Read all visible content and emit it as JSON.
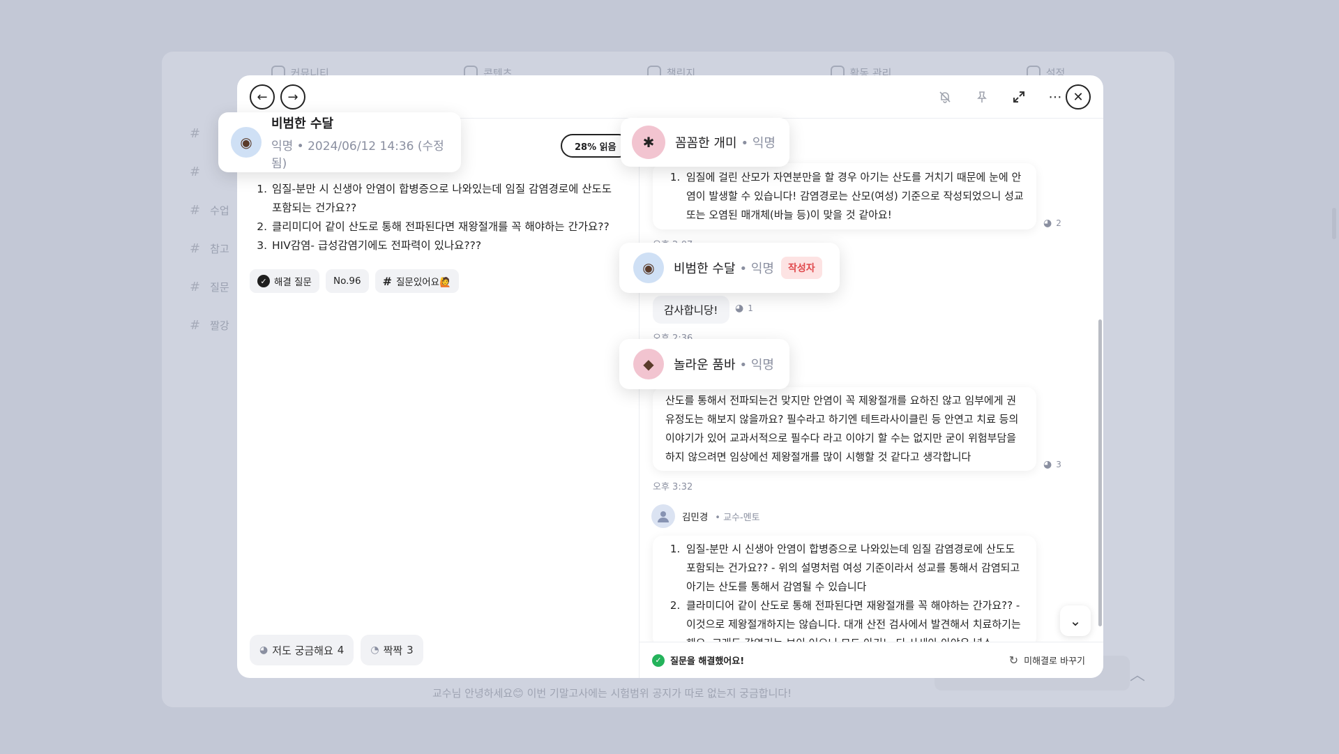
{
  "background": {
    "nav": [
      "커뮤니티",
      "콘텐츠",
      "챌린지",
      "활동 관리",
      "설정"
    ],
    "sidebar": [
      "",
      "",
      "수업",
      "참고",
      "질문",
      "짤강"
    ],
    "footer_text": "교수님 안녕하세요😊 이번 기말고사에는 시험범위 공지가 따로 없는지 궁금합니다!",
    "right_text": "!"
  },
  "toolbar": {
    "back_icon": "arrow-left-icon",
    "forward_icon": "arrow-right-icon",
    "mute_icon": "bell-off-icon",
    "pin_icon": "pin-icon",
    "expand_icon": "expand-icon",
    "more_icon": "more-icon",
    "close_icon": "close-icon"
  },
  "post": {
    "author": "비범한 수달",
    "meta": "익명 • 2024/06/12 14:36 (수정됨)",
    "progress": "28% 읽음",
    "questions": [
      "임질-분만 시 신생아 안염이 합병증으로 나와있는데 임질 감염경로에 산도도 포함되는 건가요??",
      "클리미디어 같이 산도로 통해 전파된다면 재왕절개를 꼭 해야하는 간가요??",
      "HIV감염- 급성감염기에도 전파력이 있나요???"
    ],
    "tags": [
      "해결 질문",
      "No.96",
      "질문있어요🙋"
    ],
    "reactions": [
      {
        "label": "저도 궁금해요",
        "count": "4"
      },
      {
        "label": "짝짝",
        "count": "3"
      }
    ]
  },
  "comments": {
    "c1": {
      "author": "꼼꼼한 개미",
      "role": "• 익명",
      "items": [
        "임질에 걸린 산모가 자연분만을 할 경우 아기는 산도를 거치기 때문에 눈에 안염이 발생할 수 있습니다! 감염경로는 산모(여성) 기준으로 작성되었으니 성교 또는 오염된 매개체(바늘 등)이 맞을 것 같아요!"
      ],
      "reaction_count": "2",
      "time": "오후 2:07"
    },
    "c2": {
      "author": "비범한 수달",
      "role": "• 익명",
      "badge": "작성자",
      "text": "감사합니당!",
      "reaction_count": "1",
      "time": "오후 2:36"
    },
    "c3": {
      "author": "놀라운 품바",
      "role": "• 익명",
      "text": "산도를 통해서 전파되는건 맞지만 안염이 꼭 제왕절개를 요하진 않고 임부에게 권유정도는 해보지 않을까요? 필수라고 하기엔 테트라사이클린 등 안연고 치료 등의 이야기가 있어 교과서적으로 필수다 라고 이야기 할 수는 없지만 굳이 위험부담을 하지 않으려면 임상에선 제왕절개를 많이 시행할 것 같다고 생각합니다",
      "reaction_count": "3",
      "time": "오후 3:32"
    },
    "c4": {
      "author": "김민경",
      "role": "• 교수-멘토",
      "items": [
        "임질-분만 시 신생아 안염이 합병증으로 나와있는데 임질 감염경로에 산도도 포함되는 건가요?? - 위의 설명처럼 여성 기준이라서 성교를 통해서 감염되고 아기는 산도를 통해서 감염될 수 있습니다",
        "클라미디어 같이 산도로 통해 전파된다면 재왕절개를 꼭 해야하는 간가요?? - 이것으로 제왕절개하지는 않습니다. 대개 산전 검사에서 발견해서 치료하기는 해요. 고래도 감염기는 보이 어으니 모드 아기노 티 사새아 아야우 넣스"
      ]
    }
  },
  "bottom": {
    "resolved": "질문을 해결했어요!",
    "unresolve": "미해결로 바꾸기"
  },
  "colors": {
    "backdrop": "#c3c8d6",
    "resolved_green": "#24b35b",
    "author_badge_bg": "#fde3e3",
    "author_badge_text": "#e0494c"
  }
}
